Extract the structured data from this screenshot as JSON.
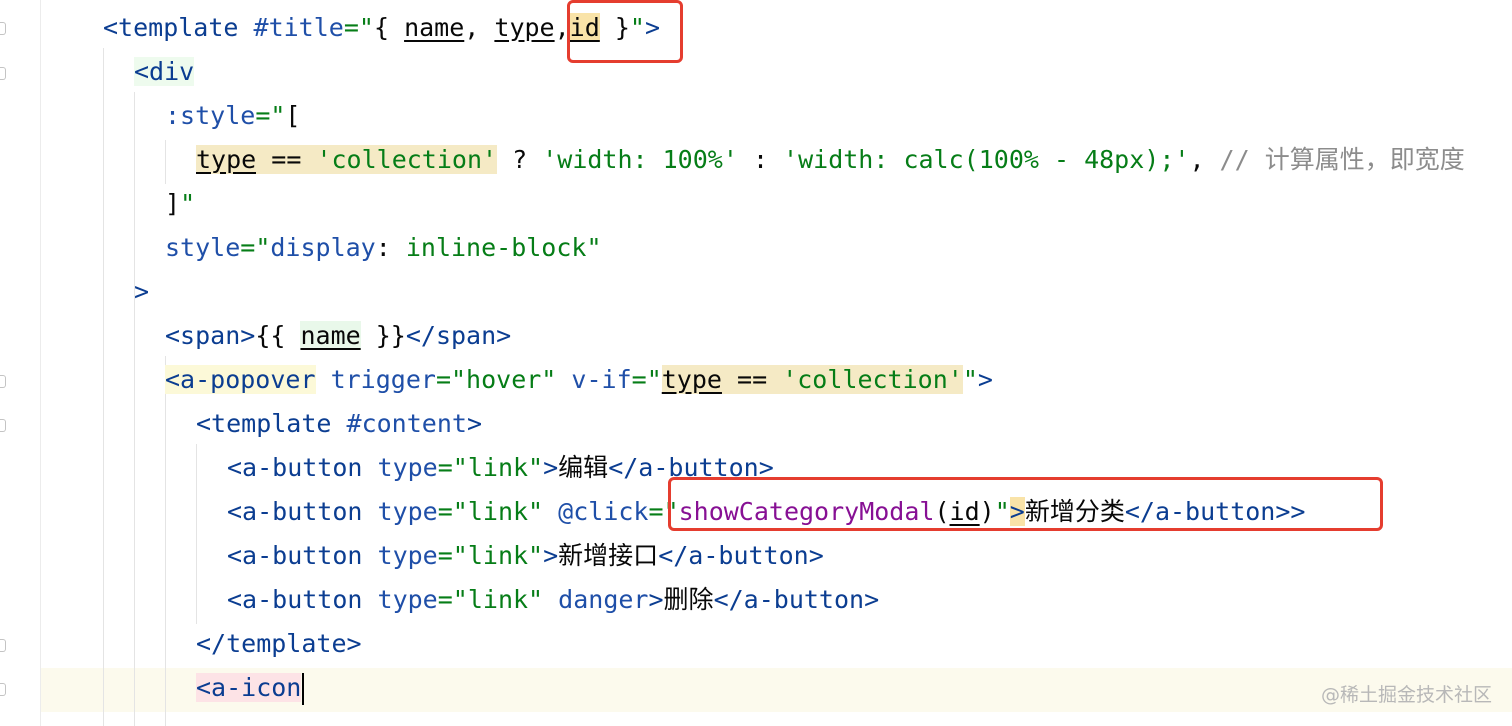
{
  "editor": {
    "lines": [
      {
        "segs": [
          {
            "t": "<template",
            "c": "tag"
          },
          {
            "t": " "
          },
          {
            "t": "#title",
            "c": "attr"
          },
          {
            "t": "=\"",
            "c": "str"
          },
          {
            "t": "{ ",
            "c": "expr"
          },
          {
            "t": "name",
            "c": "expr u"
          },
          {
            "t": ", ",
            "c": "expr"
          },
          {
            "t": "type",
            "c": "expr u"
          },
          {
            "t": ",",
            "c": "expr"
          },
          {
            "t": "id",
            "c": "expr u hl-peach"
          },
          {
            "t": " }",
            "c": "expr"
          },
          {
            "t": "\"",
            "c": "str"
          },
          {
            "t": ">",
            "c": "tag"
          }
        ]
      },
      {
        "segs": [
          {
            "t": "<div",
            "c": "tag tag-bg-green"
          }
        ]
      },
      {
        "segs": [
          {
            "t": ":style",
            "c": "attr"
          },
          {
            "t": "=\"",
            "c": "str"
          },
          {
            "t": "[",
            "c": "expr"
          }
        ]
      },
      {
        "segs": [
          {
            "t": "type",
            "c": "expr u hl-yellow"
          },
          {
            "t": " == ",
            "c": "expr hl-yellow"
          },
          {
            "t": "'collection'",
            "c": "str hl-yellow"
          },
          {
            "t": " ? ",
            "c": "expr"
          },
          {
            "t": "'width: 100%'",
            "c": "str"
          },
          {
            "t": " : ",
            "c": "expr"
          },
          {
            "t": "'width: calc(100% - 48px);'",
            "c": "str"
          },
          {
            "t": ", ",
            "c": "expr"
          },
          {
            "t": "// 计算属性，即宽度",
            "c": "comment"
          }
        ]
      },
      {
        "segs": [
          {
            "t": "]",
            "c": "expr"
          },
          {
            "t": "\"",
            "c": "str"
          }
        ]
      },
      {
        "segs": [
          {
            "t": "style",
            "c": "attr"
          },
          {
            "t": "=\"",
            "c": "str"
          },
          {
            "t": "display",
            "c": "attr"
          },
          {
            "t": ": ",
            "c": "text"
          },
          {
            "t": "inline-block",
            "c": "str"
          },
          {
            "t": "\"",
            "c": "str"
          }
        ]
      },
      {
        "segs": [
          {
            "t": ">",
            "c": "tag"
          }
        ]
      },
      {
        "segs": [
          {
            "t": "<span>",
            "c": "tag"
          },
          {
            "t": "{{ ",
            "c": "text"
          },
          {
            "t": "name",
            "c": "expr u hl-green"
          },
          {
            "t": " }}",
            "c": "text"
          },
          {
            "t": "</span>",
            "c": "tag"
          }
        ]
      },
      {
        "segs": [
          {
            "t": "<a-popover",
            "c": "tag tag-bg-yellow"
          },
          {
            "t": " "
          },
          {
            "t": "trigger",
            "c": "attr"
          },
          {
            "t": "=\"hover\"",
            "c": "str"
          },
          {
            "t": " "
          },
          {
            "t": "v-if",
            "c": "attr"
          },
          {
            "t": "=\"",
            "c": "str"
          },
          {
            "t": "type",
            "c": "expr u hl-yellow"
          },
          {
            "t": " == ",
            "c": "expr hl-yellow"
          },
          {
            "t": "'collection'",
            "c": "str hl-yellow"
          },
          {
            "t": "\"",
            "c": "str"
          },
          {
            "t": ">",
            "c": "tag"
          }
        ]
      },
      {
        "segs": [
          {
            "t": "<template",
            "c": "tag"
          },
          {
            "t": " "
          },
          {
            "t": "#content",
            "c": "attr"
          },
          {
            "t": ">",
            "c": "tag"
          }
        ]
      },
      {
        "segs": [
          {
            "t": "<a-button",
            "c": "tag"
          },
          {
            "t": " "
          },
          {
            "t": "type",
            "c": "attr"
          },
          {
            "t": "=\"link\"",
            "c": "str"
          },
          {
            "t": ">",
            "c": "tag"
          },
          {
            "t": "编辑",
            "c": "text"
          },
          {
            "t": "</a-button>",
            "c": "tag"
          }
        ]
      },
      {
        "segs": [
          {
            "t": "<a-button",
            "c": "tag"
          },
          {
            "t": " "
          },
          {
            "t": "type",
            "c": "attr"
          },
          {
            "t": "=\"link\"",
            "c": "str"
          },
          {
            "t": " "
          },
          {
            "t": "@click",
            "c": "attr"
          },
          {
            "t": "=\"",
            "c": "str"
          },
          {
            "t": "showCategoryModal",
            "c": "fn"
          },
          {
            "t": "(",
            "c": "expr"
          },
          {
            "t": "id",
            "c": "expr u"
          },
          {
            "t": ")",
            "c": "expr"
          },
          {
            "t": "\"",
            "c": "str"
          },
          {
            "t": ">",
            "c": "tag hl-peach"
          },
          {
            "t": "新增分类",
            "c": "text"
          },
          {
            "t": "</a-button>",
            "c": "tag"
          },
          {
            "t": ">",
            "c": "tag"
          }
        ]
      },
      {
        "segs": [
          {
            "t": "<a-button",
            "c": "tag"
          },
          {
            "t": " "
          },
          {
            "t": "type",
            "c": "attr"
          },
          {
            "t": "=\"link\"",
            "c": "str"
          },
          {
            "t": ">",
            "c": "tag"
          },
          {
            "t": "新增接口",
            "c": "text"
          },
          {
            "t": "</a-button>",
            "c": "tag"
          }
        ]
      },
      {
        "segs": [
          {
            "t": "<a-button",
            "c": "tag"
          },
          {
            "t": " "
          },
          {
            "t": "type",
            "c": "attr"
          },
          {
            "t": "=\"link\"",
            "c": "str"
          },
          {
            "t": " "
          },
          {
            "t": "danger",
            "c": "attr"
          },
          {
            "t": ">",
            "c": "tag"
          },
          {
            "t": "删除",
            "c": "text"
          },
          {
            "t": "</a-button>",
            "c": "tag"
          }
        ]
      },
      {
        "segs": [
          {
            "t": "</template>",
            "c": "tag"
          }
        ]
      },
      {
        "segs": [
          {
            "t": "<a-icon",
            "c": "tag tag-bg-pink"
          }
        ]
      }
    ]
  },
  "watermark": "@稀土掘金技术社区"
}
